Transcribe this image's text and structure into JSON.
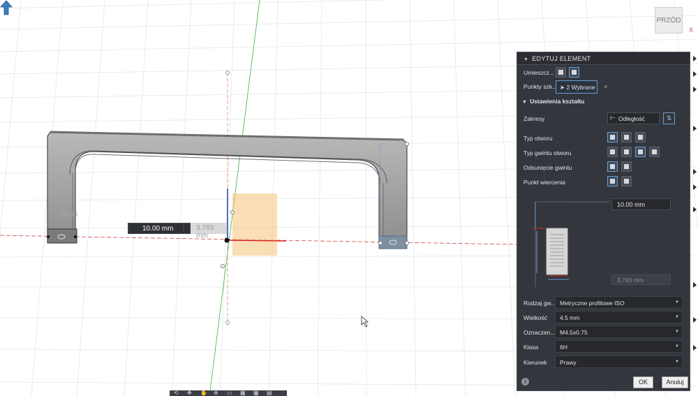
{
  "viewcube": {
    "face_label": "PRZÓD",
    "axis_x": "X"
  },
  "canvas": {
    "dim_value_active": "10.00 mm",
    "dim_value_secondary": "3.783 mm",
    "dim_separator": "⋮",
    "ghost_label": "10.00"
  },
  "toolbar": {
    "icons": [
      "orbit-icon",
      "pan-icon",
      "hand-icon",
      "zoom-icon",
      "display-icon",
      "grid-icon",
      "grid2-icon",
      "view-icon"
    ]
  },
  "panel": {
    "title": "EDYTUJ ELEMENT",
    "placement_label": "Umieszcz...",
    "points_label": "Punkty szk...",
    "points_value": "2 Wybrane",
    "clear_symbol": "×",
    "section_title": "Ustawienia kształtu",
    "extents_label": "Zakresy",
    "extents_value": "Odległość",
    "hole_type_label": "Typ otworu",
    "tap_type_label": "Typ gwintu otworu",
    "thread_offset_label": "Odsunięcie gwintu",
    "drill_point_label": "Punkt wiercenia",
    "preview_top_dim": "10.00 mm",
    "preview_bottom_dim": "3.783 mm",
    "thread_type_label": "Rodzaj gw...",
    "thread_type_value": "Metryczne profilowe ISO",
    "size_label": "Wielkość",
    "size_value": "4.5 mm",
    "designation_label": "Oznaczen...",
    "designation_value": "M4.5x0.75",
    "class_label": "Klasa",
    "class_value": "6H",
    "direction_label": "Kierunek",
    "direction_value": "Prawy",
    "ok_label": "OK",
    "cancel_label": "Anuluj",
    "info_symbol": "i"
  },
  "colors": {
    "panel_bg": "#33363c",
    "accent": "#6b9ed6",
    "model_fill": "#8a8a8a",
    "preview_orange": "#f5c27a"
  }
}
